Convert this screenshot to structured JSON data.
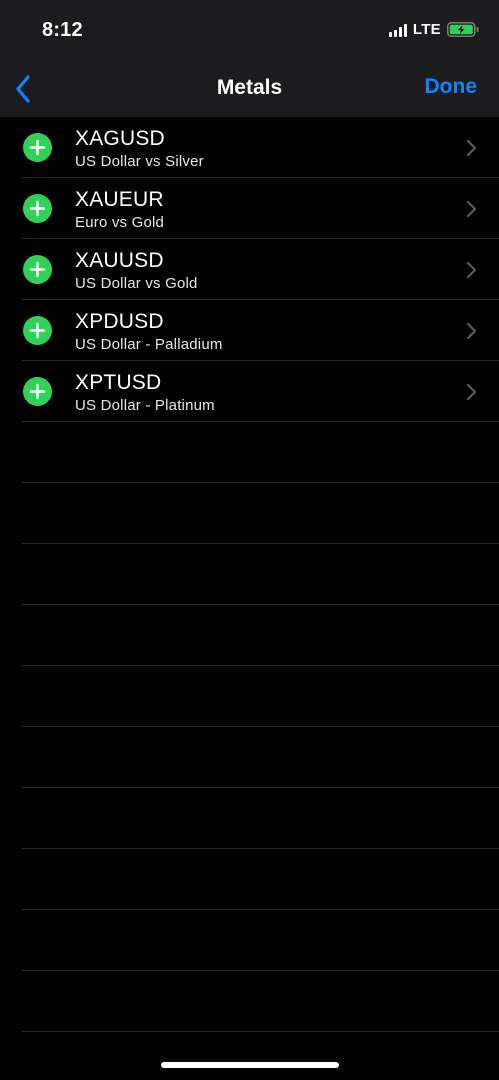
{
  "status_bar": {
    "time": "8:12",
    "network": "LTE",
    "battery_color": "#30d158"
  },
  "nav": {
    "back_icon": "chevron-left-icon",
    "title": "Metals",
    "done_label": "Done",
    "accent_color": "#0a84ff"
  },
  "instruments": [
    {
      "symbol": "XAGUSD",
      "description": "US Dollar vs Silver"
    },
    {
      "symbol": "XAUEUR",
      "description": "Euro vs Gold"
    },
    {
      "symbol": "XAUUSD",
      "description": "US Dollar vs Gold"
    },
    {
      "symbol": "XPDUSD",
      "description": "US Dollar - Palladium"
    },
    {
      "symbol": "XPTUSD",
      "description": "US Dollar - Platinum"
    }
  ],
  "row_icons": {
    "add": "plus-circle-icon",
    "add_color": "#30d158",
    "disclosure": "chevron-right-icon"
  }
}
